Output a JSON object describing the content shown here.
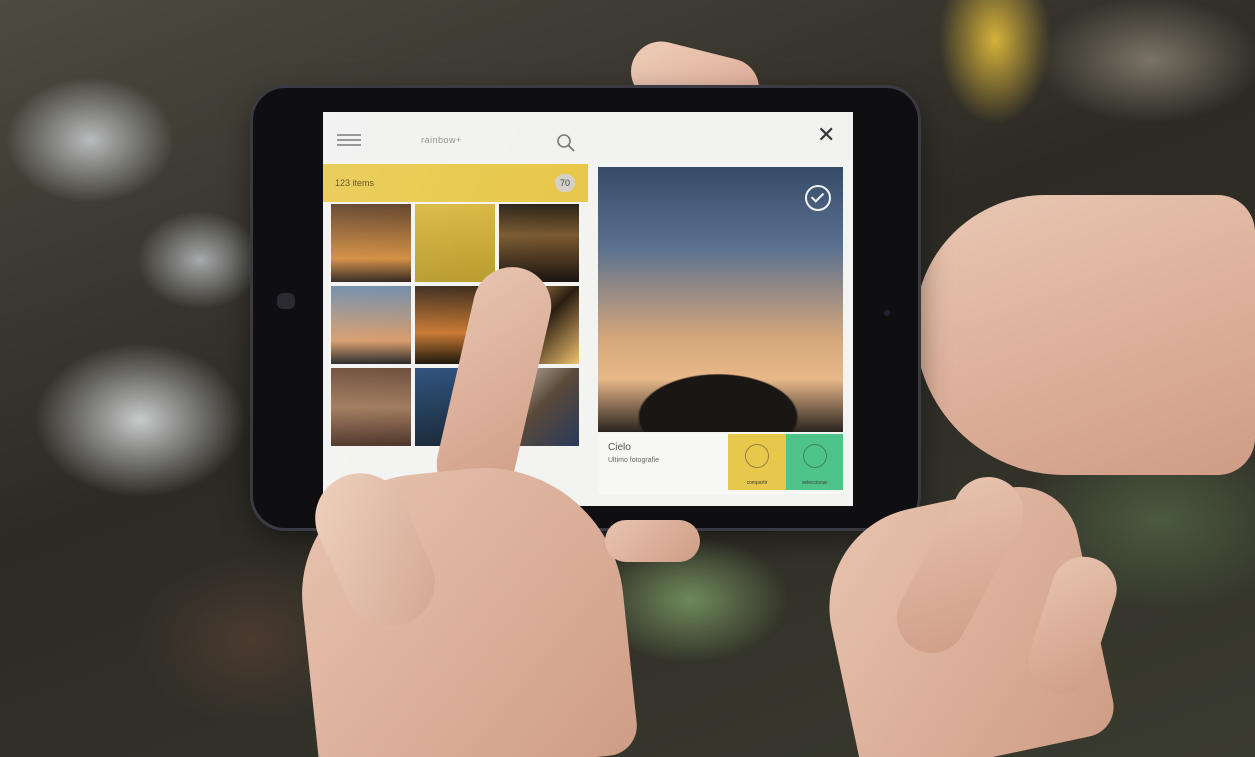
{
  "app": {
    "title": "rainbow+",
    "menu_icon": "hamburger-icon",
    "search_icon": "search-icon",
    "close_icon": "close-icon",
    "close_glyph": "✕"
  },
  "album": {
    "label": "123 items",
    "count": "70"
  },
  "preview": {
    "title": "Cielo",
    "subtitle": "Ultimo fotografie",
    "selected": true
  },
  "actions": {
    "left_label": "compartir",
    "right_label": "seleccionar"
  },
  "colors": {
    "accent_yellow": "#e8c84a",
    "accent_green": "#4fc48a"
  }
}
